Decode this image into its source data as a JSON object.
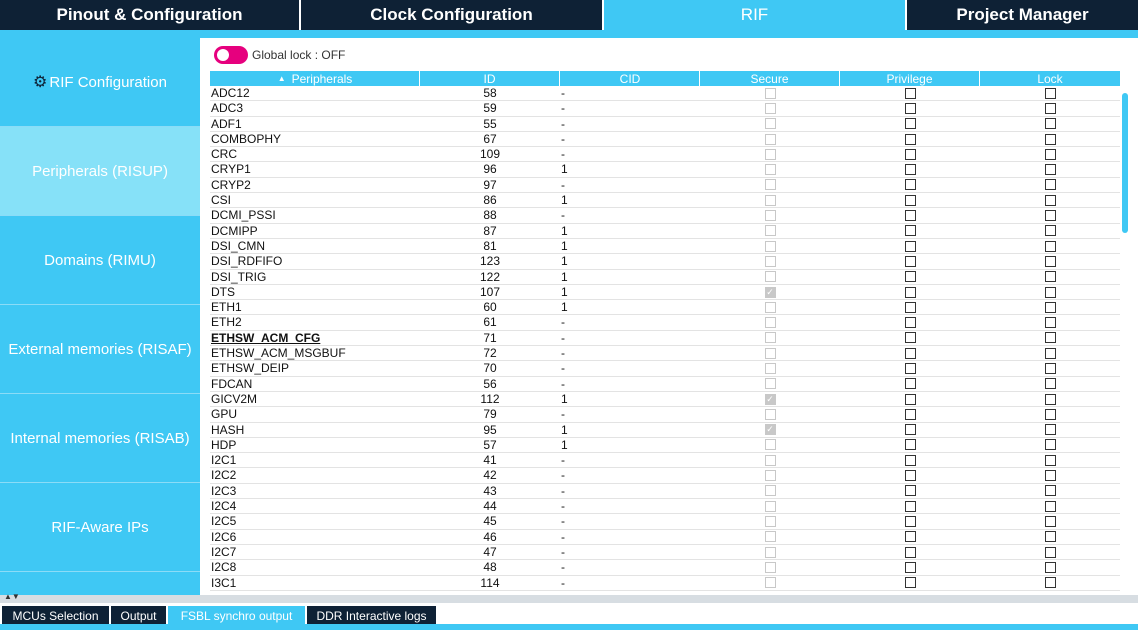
{
  "top_tabs": [
    {
      "label": "Pinout & Configuration",
      "active": false
    },
    {
      "label": "Clock Configuration",
      "active": false
    },
    {
      "label": "RIF",
      "active": true
    },
    {
      "label": "Project Manager",
      "active": false
    }
  ],
  "sidebar": {
    "items": [
      {
        "label": "RIF Configuration",
        "icon": "gear-icon"
      },
      {
        "label": "Peripherals (RISUP)",
        "active": true
      },
      {
        "label": "Domains (RIMU)"
      },
      {
        "label": "External memories (RISAF)"
      },
      {
        "label": "Internal memories (RISAB)"
      },
      {
        "label": "RIF-Aware IPs"
      }
    ]
  },
  "global_lock": {
    "label": "Global lock : OFF",
    "state": "off",
    "toggle_color": "#e6007e"
  },
  "table": {
    "headers": [
      "Peripherals",
      "ID",
      "CID",
      "Secure",
      "Privilege",
      "Lock"
    ],
    "rows": [
      {
        "name": "ADC12",
        "id": "58",
        "cid": "-",
        "secure": "disabled",
        "privilege": false,
        "lock": false
      },
      {
        "name": "ADC3",
        "id": "59",
        "cid": "-",
        "secure": "disabled",
        "privilege": false,
        "lock": false
      },
      {
        "name": "ADF1",
        "id": "55",
        "cid": "-",
        "secure": "disabled",
        "privilege": false,
        "lock": false
      },
      {
        "name": "COMBOPHY",
        "id": "67",
        "cid": "-",
        "secure": "disabled",
        "privilege": false,
        "lock": false
      },
      {
        "name": "CRC",
        "id": "109",
        "cid": "-",
        "secure": "disabled",
        "privilege": false,
        "lock": false
      },
      {
        "name": "CRYP1",
        "id": "96",
        "cid": "1",
        "secure": "disabled",
        "privilege": false,
        "lock": false
      },
      {
        "name": "CRYP2",
        "id": "97",
        "cid": "-",
        "secure": "disabled",
        "privilege": false,
        "lock": false
      },
      {
        "name": "CSI",
        "id": "86",
        "cid": "1",
        "secure": "disabled",
        "privilege": false,
        "lock": false
      },
      {
        "name": "DCMI_PSSI",
        "id": "88",
        "cid": "-",
        "secure": "disabled",
        "privilege": false,
        "lock": false
      },
      {
        "name": "DCMIPP",
        "id": "87",
        "cid": "1",
        "secure": "disabled",
        "privilege": false,
        "lock": false
      },
      {
        "name": "DSI_CMN",
        "id": "81",
        "cid": "1",
        "secure": "disabled",
        "privilege": false,
        "lock": false
      },
      {
        "name": "DSI_RDFIFO",
        "id": "123",
        "cid": "1",
        "secure": "disabled",
        "privilege": false,
        "lock": false
      },
      {
        "name": "DSI_TRIG",
        "id": "122",
        "cid": "1",
        "secure": "disabled",
        "privilege": false,
        "lock": false
      },
      {
        "name": "DTS",
        "id": "107",
        "cid": "1",
        "secure": "checked",
        "privilege": false,
        "lock": false
      },
      {
        "name": "ETH1",
        "id": "60",
        "cid": "1",
        "secure": "disabled",
        "privilege": false,
        "lock": false
      },
      {
        "name": "ETH2",
        "id": "61",
        "cid": "-",
        "secure": "disabled",
        "privilege": false,
        "lock": false
      },
      {
        "name": "ETHSW_ACM_CFG",
        "id": "71",
        "cid": "-",
        "secure": "disabled",
        "privilege": false,
        "lock": false,
        "highlight": true
      },
      {
        "name": "ETHSW_ACM_MSGBUF",
        "id": "72",
        "cid": "-",
        "secure": "disabled",
        "privilege": false,
        "lock": false
      },
      {
        "name": "ETHSW_DEIP",
        "id": "70",
        "cid": "-",
        "secure": "disabled",
        "privilege": false,
        "lock": false
      },
      {
        "name": "FDCAN",
        "id": "56",
        "cid": "-",
        "secure": "disabled",
        "privilege": false,
        "lock": false
      },
      {
        "name": "GICV2M",
        "id": "112",
        "cid": "1",
        "secure": "checked",
        "privilege": false,
        "lock": false
      },
      {
        "name": "GPU",
        "id": "79",
        "cid": "-",
        "secure": "disabled",
        "privilege": false,
        "lock": false
      },
      {
        "name": "HASH",
        "id": "95",
        "cid": "1",
        "secure": "checked",
        "privilege": false,
        "lock": false
      },
      {
        "name": "HDP",
        "id": "57",
        "cid": "1",
        "secure": "disabled",
        "privilege": false,
        "lock": false
      },
      {
        "name": "I2C1",
        "id": "41",
        "cid": "-",
        "secure": "disabled",
        "privilege": false,
        "lock": false
      },
      {
        "name": "I2C2",
        "id": "42",
        "cid": "-",
        "secure": "disabled",
        "privilege": false,
        "lock": false
      },
      {
        "name": "I2C3",
        "id": "43",
        "cid": "-",
        "secure": "disabled",
        "privilege": false,
        "lock": false
      },
      {
        "name": "I2C4",
        "id": "44",
        "cid": "-",
        "secure": "disabled",
        "privilege": false,
        "lock": false
      },
      {
        "name": "I2C5",
        "id": "45",
        "cid": "-",
        "secure": "disabled",
        "privilege": false,
        "lock": false
      },
      {
        "name": "I2C6",
        "id": "46",
        "cid": "-",
        "secure": "disabled",
        "privilege": false,
        "lock": false
      },
      {
        "name": "I2C7",
        "id": "47",
        "cid": "-",
        "secure": "disabled",
        "privilege": false,
        "lock": false
      },
      {
        "name": "I2C8",
        "id": "48",
        "cid": "-",
        "secure": "disabled",
        "privilege": false,
        "lock": false
      },
      {
        "name": "I3C1",
        "id": "114",
        "cid": "-",
        "secure": "disabled",
        "privilege": false,
        "lock": false
      }
    ]
  },
  "bottom_tabs": [
    {
      "label": "MCUs Selection",
      "active": false
    },
    {
      "label": "Output",
      "active": false
    },
    {
      "label": "FSBL synchro output",
      "active": true
    },
    {
      "label": "DDR Interactive logs",
      "active": false
    }
  ]
}
